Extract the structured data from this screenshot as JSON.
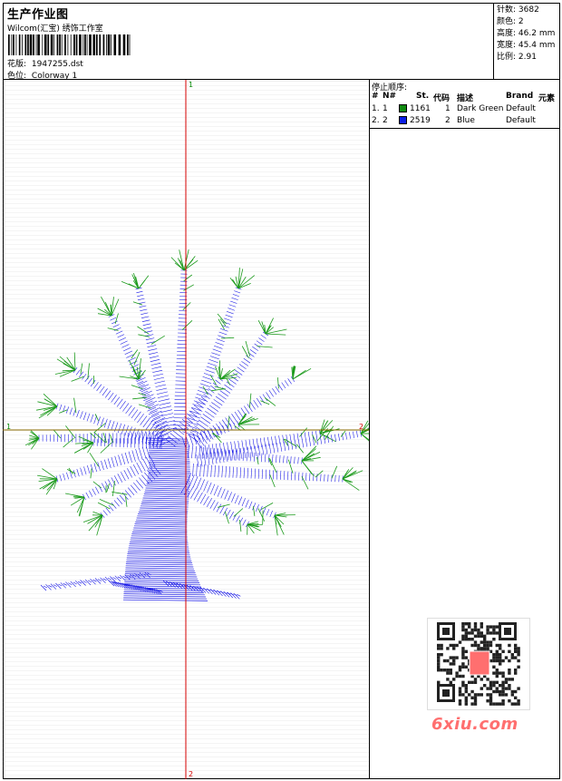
{
  "header": {
    "title": "生产作业图",
    "company": "Wilcom(汇宝) 绣饰工作室",
    "design_label": "花版:",
    "design_value": "1947255.dst",
    "colorway_label": "色位:",
    "colorway_value": "Colorway 1"
  },
  "stats": {
    "stitches_label": "针数:",
    "stitches_value": "3682",
    "colors_label": "颜色:",
    "colors_value": "2",
    "height_label": "高度:",
    "height_value": "46.2 mm",
    "width_label": "宽度:",
    "width_value": "45.4 mm",
    "scale_label": "比例:",
    "scale_value": "2.91"
  },
  "stop_sequence": {
    "title": "停止顺序:",
    "headers": {
      "num": "#",
      "code": "N#",
      "st": "St.",
      "daihao": "代码",
      "desc": "描述",
      "brand": "Brand",
      "element": "元素"
    },
    "rows": [
      {
        "num": "1.",
        "code": "1",
        "swatch": "#0f8a0f",
        "st": "1161",
        "daihao": "1",
        "desc": "Dark Green",
        "brand": "Default"
      },
      {
        "num": "2.",
        "code": "2",
        "swatch": "#0a1ee6",
        "st": "2519",
        "daihao": "2",
        "desc": "Blue",
        "brand": "Default"
      }
    ]
  },
  "axis_labels": {
    "top": "1",
    "bottom": "2",
    "left": "1",
    "right": "2"
  },
  "watermark": {
    "site": "6xiu.com"
  },
  "colors": {
    "green": "#1a9a1a",
    "blue": "#1414e6",
    "axis_v": "#d40000",
    "axis_h": "#8a6a00"
  }
}
